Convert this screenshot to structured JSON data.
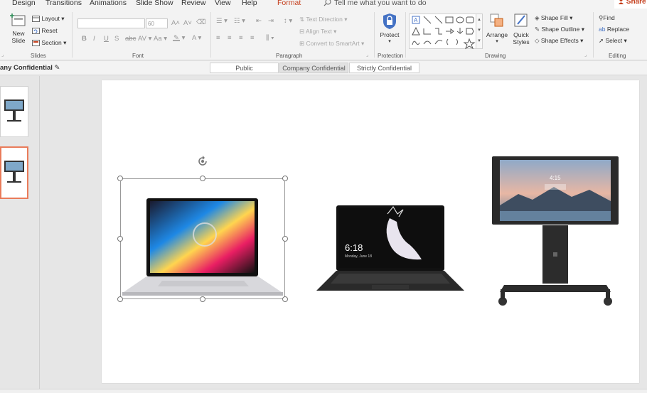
{
  "tabs": [
    "Design",
    "Transitions",
    "Animations",
    "Slide Show",
    "Review",
    "View",
    "Help",
    "Format"
  ],
  "search_text": "Tell me what you want to do",
  "share_label": "Share",
  "groups": {
    "slides": {
      "label": "Slides",
      "new_slide": "New Slide",
      "layout": "Layout",
      "reset": "Reset",
      "section": "Section"
    },
    "font": {
      "label": "Font",
      "font_size": "60",
      "bold": "B",
      "italic": "I",
      "underline": "U",
      "strike": "S",
      "spacing": "AV",
      "grow": "A",
      "case": "Aa"
    },
    "paragraph": {
      "label": "Paragraph",
      "text_direction": "Text Direction",
      "align_text": "Align Text",
      "smartart": "Convert to SmartArt"
    },
    "protection": {
      "label": "Protection",
      "protect": "Protect"
    },
    "drawing": {
      "label": "Drawing",
      "arrange": "Arrange",
      "quick_styles": "Quick Styles",
      "shape_fill": "Shape Fill",
      "shape_outline": "Shape Outline",
      "shape_effects": "Shape Effects"
    },
    "editing": {
      "label": "Editing",
      "find": "Find",
      "replace": "Replace",
      "select": "Select"
    }
  },
  "sensitivity": {
    "current": "any Confidential",
    "options": [
      "Public",
      "Company Confidential",
      "Strictly Confidential"
    ],
    "selected": "Company Confidential"
  },
  "slide": {
    "tablet_time": "6:18",
    "tablet_date": "Monday, June 18",
    "hub_time": "4:15"
  },
  "colors": {
    "accent": "#c43e1c",
    "ribbon_bg": "#f3f3f3",
    "selection": "#e97b5a"
  }
}
